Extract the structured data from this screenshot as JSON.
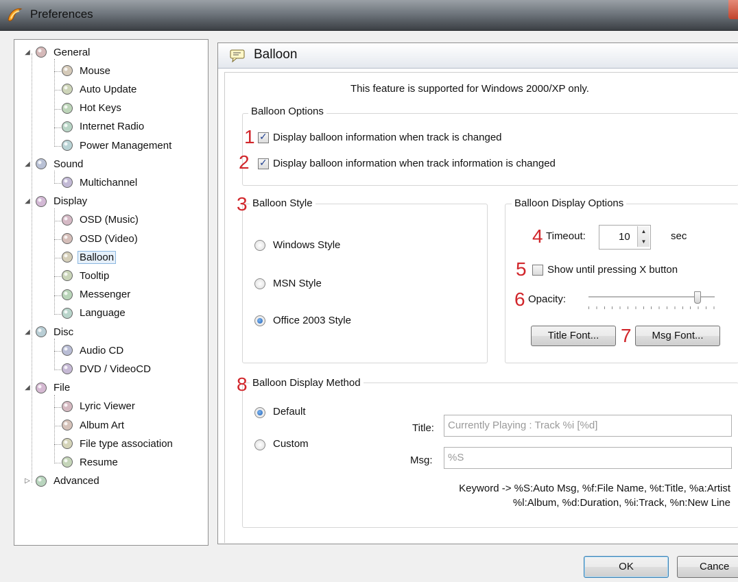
{
  "window": {
    "title": "Preferences"
  },
  "tree": [
    {
      "label": "General",
      "level": 0,
      "expander": "◢",
      "icon": "general-icon"
    },
    {
      "label": "Mouse",
      "level": 1,
      "icon": "mouse-icon"
    },
    {
      "label": "Auto Update",
      "level": 1,
      "icon": "auto-update-icon"
    },
    {
      "label": "Hot Keys",
      "level": 1,
      "icon": "hot-keys-icon"
    },
    {
      "label": "Internet Radio",
      "level": 1,
      "icon": "internet-radio-icon"
    },
    {
      "label": "Power Management",
      "level": 1,
      "icon": "power-management-icon"
    },
    {
      "label": "Sound",
      "level": 0,
      "expander": "◢",
      "icon": "sound-icon"
    },
    {
      "label": "Multichannel",
      "level": 1,
      "icon": "multichannel-icon"
    },
    {
      "label": "Display",
      "level": 0,
      "expander": "◢",
      "icon": "display-icon"
    },
    {
      "label": "OSD (Music)",
      "level": 1,
      "icon": "osd-music-icon"
    },
    {
      "label": "OSD (Video)",
      "level": 1,
      "icon": "osd-video-icon"
    },
    {
      "label": "Balloon",
      "level": 1,
      "icon": "balloon-icon",
      "selected": true
    },
    {
      "label": "Tooltip",
      "level": 1,
      "icon": "tooltip-icon"
    },
    {
      "label": "Messenger",
      "level": 1,
      "icon": "messenger-icon"
    },
    {
      "label": "Language",
      "level": 1,
      "icon": "language-icon"
    },
    {
      "label": "Disc",
      "level": 0,
      "expander": "◢",
      "icon": "disc-icon"
    },
    {
      "label": "Audio CD",
      "level": 1,
      "icon": "audio-cd-icon"
    },
    {
      "label": "DVD / VideoCD",
      "level": 1,
      "icon": "dvd-icon"
    },
    {
      "label": "File",
      "level": 0,
      "expander": "◢",
      "icon": "file-icon"
    },
    {
      "label": "Lyric Viewer",
      "level": 1,
      "icon": "lyric-viewer-icon"
    },
    {
      "label": "Album Art",
      "level": 1,
      "icon": "album-art-icon"
    },
    {
      "label": "File type association",
      "level": 1,
      "icon": "file-type-icon"
    },
    {
      "label": "Resume",
      "level": 1,
      "icon": "resume-icon"
    },
    {
      "label": "Advanced",
      "level": 0,
      "expander": "▷",
      "icon": "advanced-icon"
    }
  ],
  "panel": {
    "title": "Balloon"
  },
  "note": "This feature is supported for Windows 2000/XP only.",
  "balloon_options": {
    "legend": "Balloon Options",
    "opt1": "Display balloon information when track is changed",
    "opt2": "Display balloon information when track information is changed",
    "opt1_checked": true,
    "opt2_checked": true
  },
  "balloon_style": {
    "legend": "Balloon Style",
    "options": [
      "Windows Style",
      "MSN Style",
      "Office 2003 Style"
    ],
    "selected": "Office 2003 Style"
  },
  "display_options": {
    "legend": "Balloon Display Options",
    "timeout_label": "Timeout:",
    "timeout_value": "10",
    "timeout_unit": "sec",
    "show_until_label": "Show until pressing X button",
    "show_until_checked": false,
    "opacity_label": "Opacity:",
    "opacity_level": 0.86,
    "title_font_button": "Title Font...",
    "msg_font_button": "Msg Font..."
  },
  "display_method": {
    "legend": "Balloon Display Method",
    "default_label": "Default",
    "custom_label": "Custom",
    "selected": "Default",
    "title_label": "Title:",
    "title_value": "Currently Playing : Track %i [%d]",
    "msg_label": "Msg:",
    "msg_value": "%S",
    "keyword_line1": "Keyword -> %S:Auto Msg, %f:File Name, %t:Title, %a:Artist",
    "keyword_line2": "%l:Album, %d:Duration, %i:Track, %n:New Line"
  },
  "annotations": [
    "1",
    "2",
    "3",
    "4",
    "5",
    "6",
    "7",
    "8"
  ],
  "buttons": {
    "ok": "OK",
    "cancel": "Cance"
  },
  "colors": {
    "annotation": "#d1262b",
    "selection": "#e6f0fa",
    "accent": "#1d5fb5"
  }
}
